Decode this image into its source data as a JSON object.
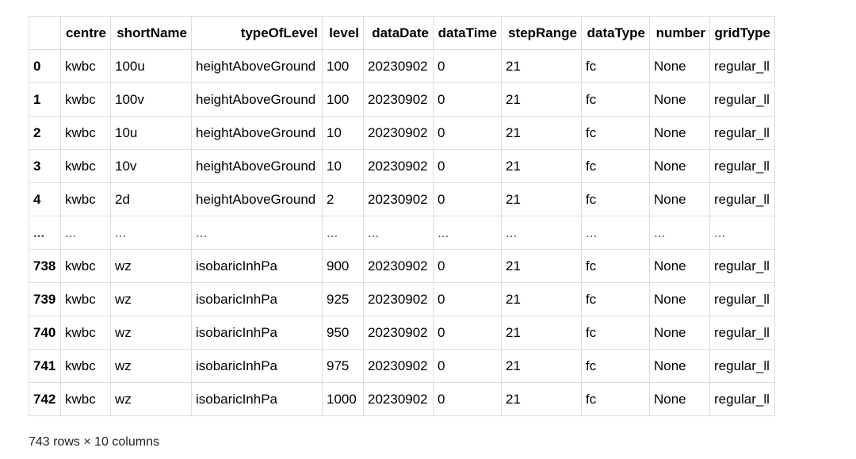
{
  "table": {
    "columns": [
      "",
      "centre",
      "shortName",
      "typeOfLevel",
      "level",
      "dataDate",
      "dataTime",
      "stepRange",
      "dataType",
      "number",
      "gridType"
    ],
    "rows": [
      [
        "0",
        "kwbc",
        "100u",
        "heightAboveGround",
        "100",
        "20230902",
        "0",
        "21",
        "fc",
        "None",
        "regular_ll"
      ],
      [
        "1",
        "kwbc",
        "100v",
        "heightAboveGround",
        "100",
        "20230902",
        "0",
        "21",
        "fc",
        "None",
        "regular_ll"
      ],
      [
        "2",
        "kwbc",
        "10u",
        "heightAboveGround",
        "10",
        "20230902",
        "0",
        "21",
        "fc",
        "None",
        "regular_ll"
      ],
      [
        "3",
        "kwbc",
        "10v",
        "heightAboveGround",
        "10",
        "20230902",
        "0",
        "21",
        "fc",
        "None",
        "regular_ll"
      ],
      [
        "4",
        "kwbc",
        "2d",
        "heightAboveGround",
        "2",
        "20230902",
        "0",
        "21",
        "fc",
        "None",
        "regular_ll"
      ],
      [
        "...",
        "...",
        "...",
        "...",
        "...",
        "...",
        "...",
        "...",
        "...",
        "...",
        "..."
      ],
      [
        "738",
        "kwbc",
        "wz",
        "isobaricInhPa",
        "900",
        "20230902",
        "0",
        "21",
        "fc",
        "None",
        "regular_ll"
      ],
      [
        "739",
        "kwbc",
        "wz",
        "isobaricInhPa",
        "925",
        "20230902",
        "0",
        "21",
        "fc",
        "None",
        "regular_ll"
      ],
      [
        "740",
        "kwbc",
        "wz",
        "isobaricInhPa",
        "950",
        "20230902",
        "0",
        "21",
        "fc",
        "None",
        "regular_ll"
      ],
      [
        "741",
        "kwbc",
        "wz",
        "isobaricInhPa",
        "975",
        "20230902",
        "0",
        "21",
        "fc",
        "None",
        "regular_ll"
      ],
      [
        "742",
        "kwbc",
        "wz",
        "isobaricInhPa",
        "1000",
        "20230902",
        "0",
        "21",
        "fc",
        "None",
        "regular_ll"
      ]
    ]
  },
  "summary": "743 rows × 10 columns"
}
